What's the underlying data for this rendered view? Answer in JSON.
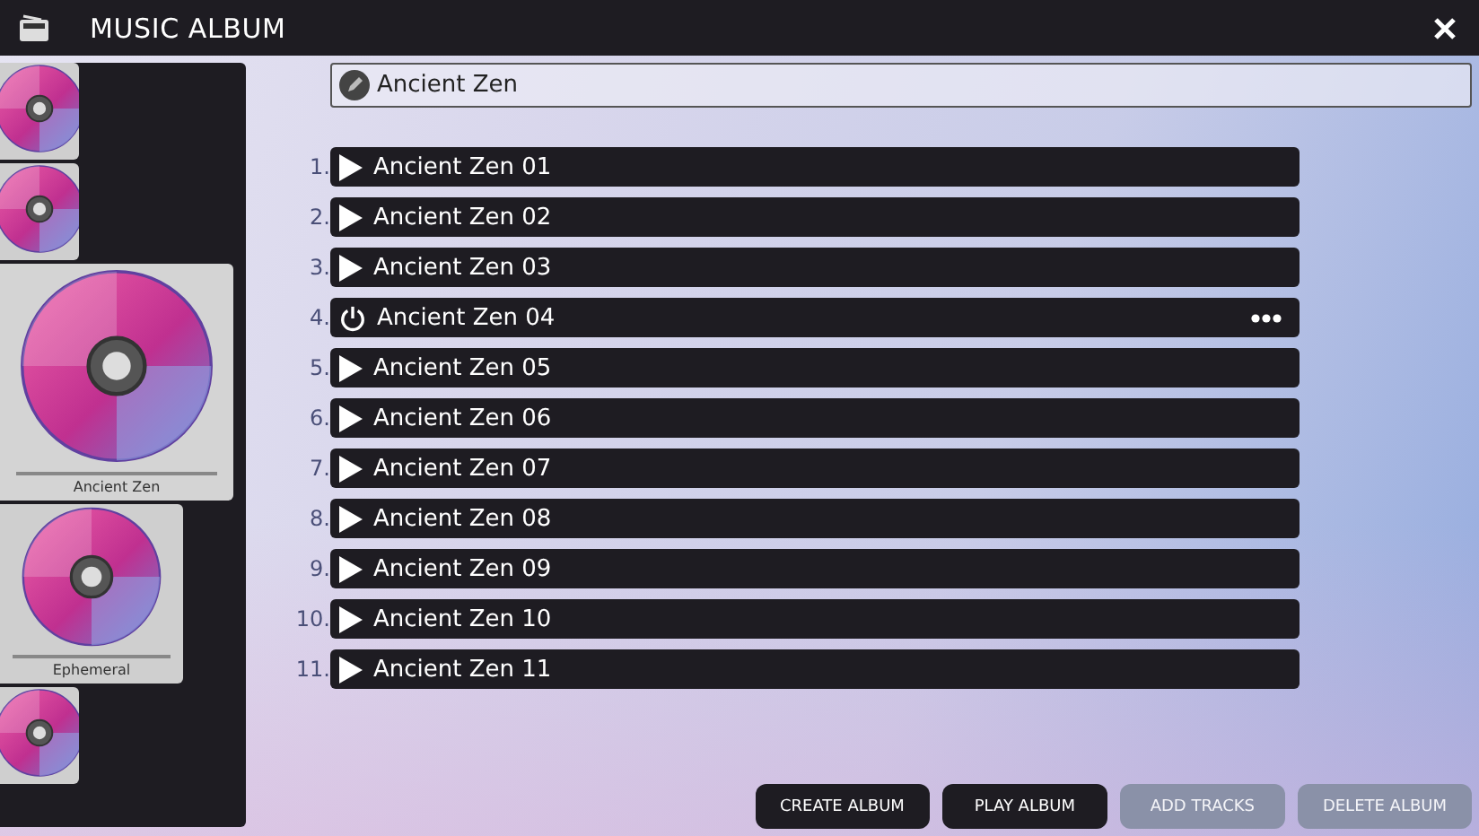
{
  "window": {
    "title": "MUSIC ALBUM"
  },
  "albums": [
    {
      "kind": "partial",
      "selected": false
    },
    {
      "kind": "partial",
      "selected": false
    },
    {
      "kind": "full",
      "label": "Ancient Zen",
      "selected": true
    },
    {
      "kind": "full",
      "label": "Ephemeral",
      "selected": false
    },
    {
      "kind": "partial",
      "selected": false
    }
  ],
  "album_name": {
    "value": "Ancient Zen"
  },
  "tracks": [
    {
      "number": "1.",
      "title": "Ancient Zen 01",
      "selected": false
    },
    {
      "number": "2.",
      "title": "Ancient Zen 02",
      "selected": false
    },
    {
      "number": "3.",
      "title": "Ancient Zen 03",
      "selected": false
    },
    {
      "number": "4.",
      "title": "Ancient Zen 04",
      "selected": true
    },
    {
      "number": "5.",
      "title": "Ancient Zen 05",
      "selected": false
    },
    {
      "number": "6.",
      "title": "Ancient Zen 06",
      "selected": false
    },
    {
      "number": "7.",
      "title": "Ancient Zen 07",
      "selected": false
    },
    {
      "number": "8.",
      "title": "Ancient Zen 08",
      "selected": false
    },
    {
      "number": "9.",
      "title": "Ancient Zen 09",
      "selected": false
    },
    {
      "number": "10.",
      "title": "Ancient Zen 10",
      "selected": false
    },
    {
      "number": "11.",
      "title": "Ancient Zen 11",
      "selected": false
    }
  ],
  "buttons": [
    {
      "label": "CREATE ALBUM",
      "disabled": false
    },
    {
      "label": "PLAY ALBUM",
      "disabled": false
    },
    {
      "label": "ADD TRACKS",
      "disabled": true
    },
    {
      "label": "DELETE ALBUM",
      "disabled": true
    }
  ]
}
